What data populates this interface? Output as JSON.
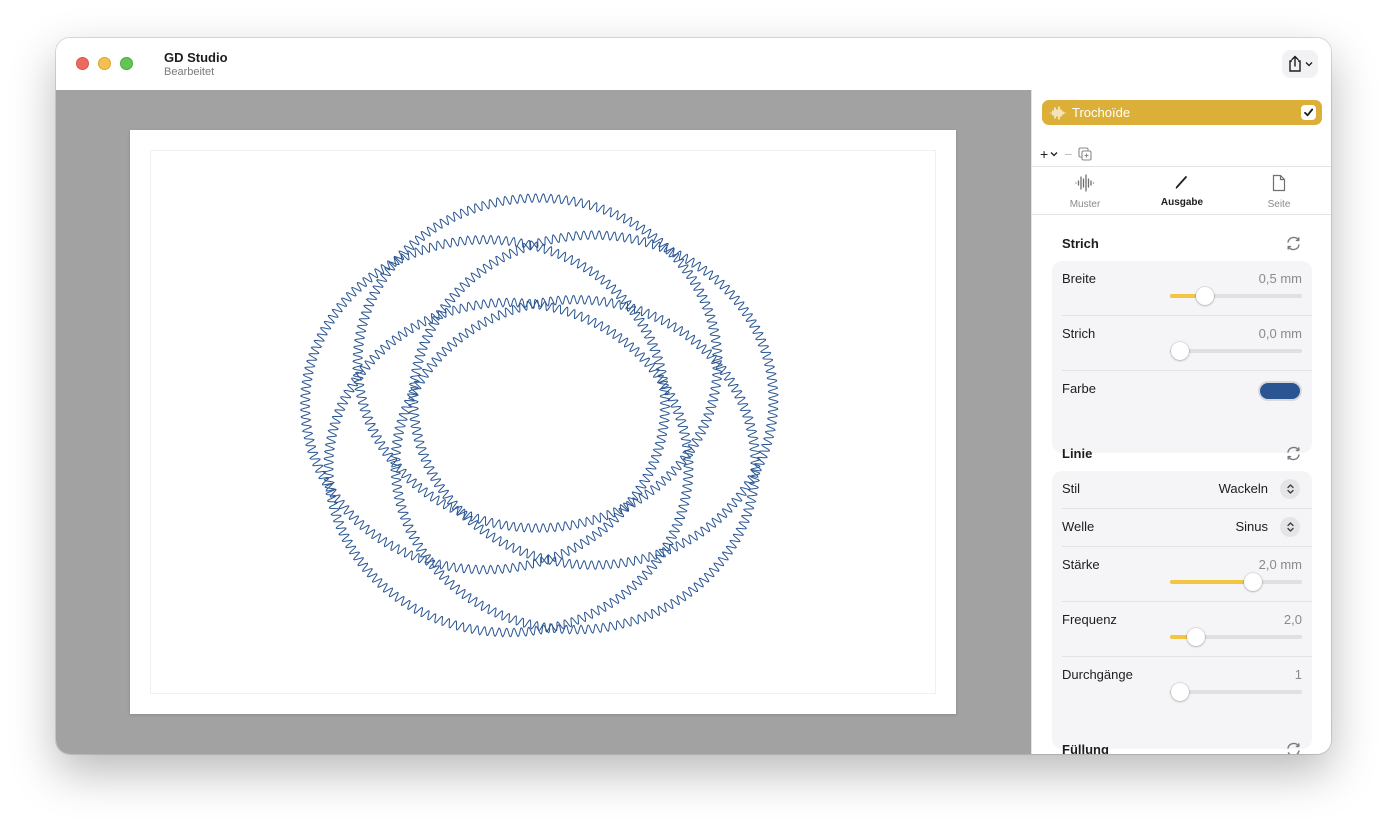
{
  "window": {
    "title": "GD Studio",
    "subtitle": "Bearbeitet"
  },
  "toolbar": {
    "share_icon": "share-icon",
    "chevron_icon": "chevron-down-icon"
  },
  "layer": {
    "name": "Trochoïde",
    "checked": true,
    "color": "#dcaf39",
    "icon": "waveform-icon"
  },
  "layer_tools": {
    "add": "+",
    "remove": "−"
  },
  "tabs": [
    {
      "label": "Muster",
      "icon": "waveform-icon",
      "active": false
    },
    {
      "label": "Ausgabe",
      "icon": "pen-icon",
      "active": true
    },
    {
      "label": "Seite",
      "icon": "page-icon",
      "active": false
    }
  ],
  "strich": {
    "title": "Strich",
    "breite": {
      "label": "Breite",
      "value": "0,5 mm",
      "fraction": 0.22
    },
    "strich": {
      "label": "Strich",
      "value": "0,0 mm",
      "fraction": 0.0
    },
    "farbe": {
      "label": "Farbe",
      "color": "#2a5592"
    }
  },
  "linie": {
    "title": "Linie",
    "stil": {
      "label": "Stil",
      "value": "Wackeln"
    },
    "welle": {
      "label": "Welle",
      "value": "Sinus"
    },
    "staerke": {
      "label": "Stärke",
      "value": "2,0 mm",
      "fraction": 0.65
    },
    "frequenz": {
      "label": "Frequenz",
      "value": "2,0",
      "fraction": 0.14
    },
    "durchgaenge": {
      "label": "Durchgänge",
      "value": "1",
      "fraction": 0.0
    }
  },
  "fuellung": {
    "title": "Füllung"
  },
  "colors": {
    "accent": "#f2c642",
    "stroke": "#2a5592",
    "canvas_bg": "#a2a2a2"
  }
}
